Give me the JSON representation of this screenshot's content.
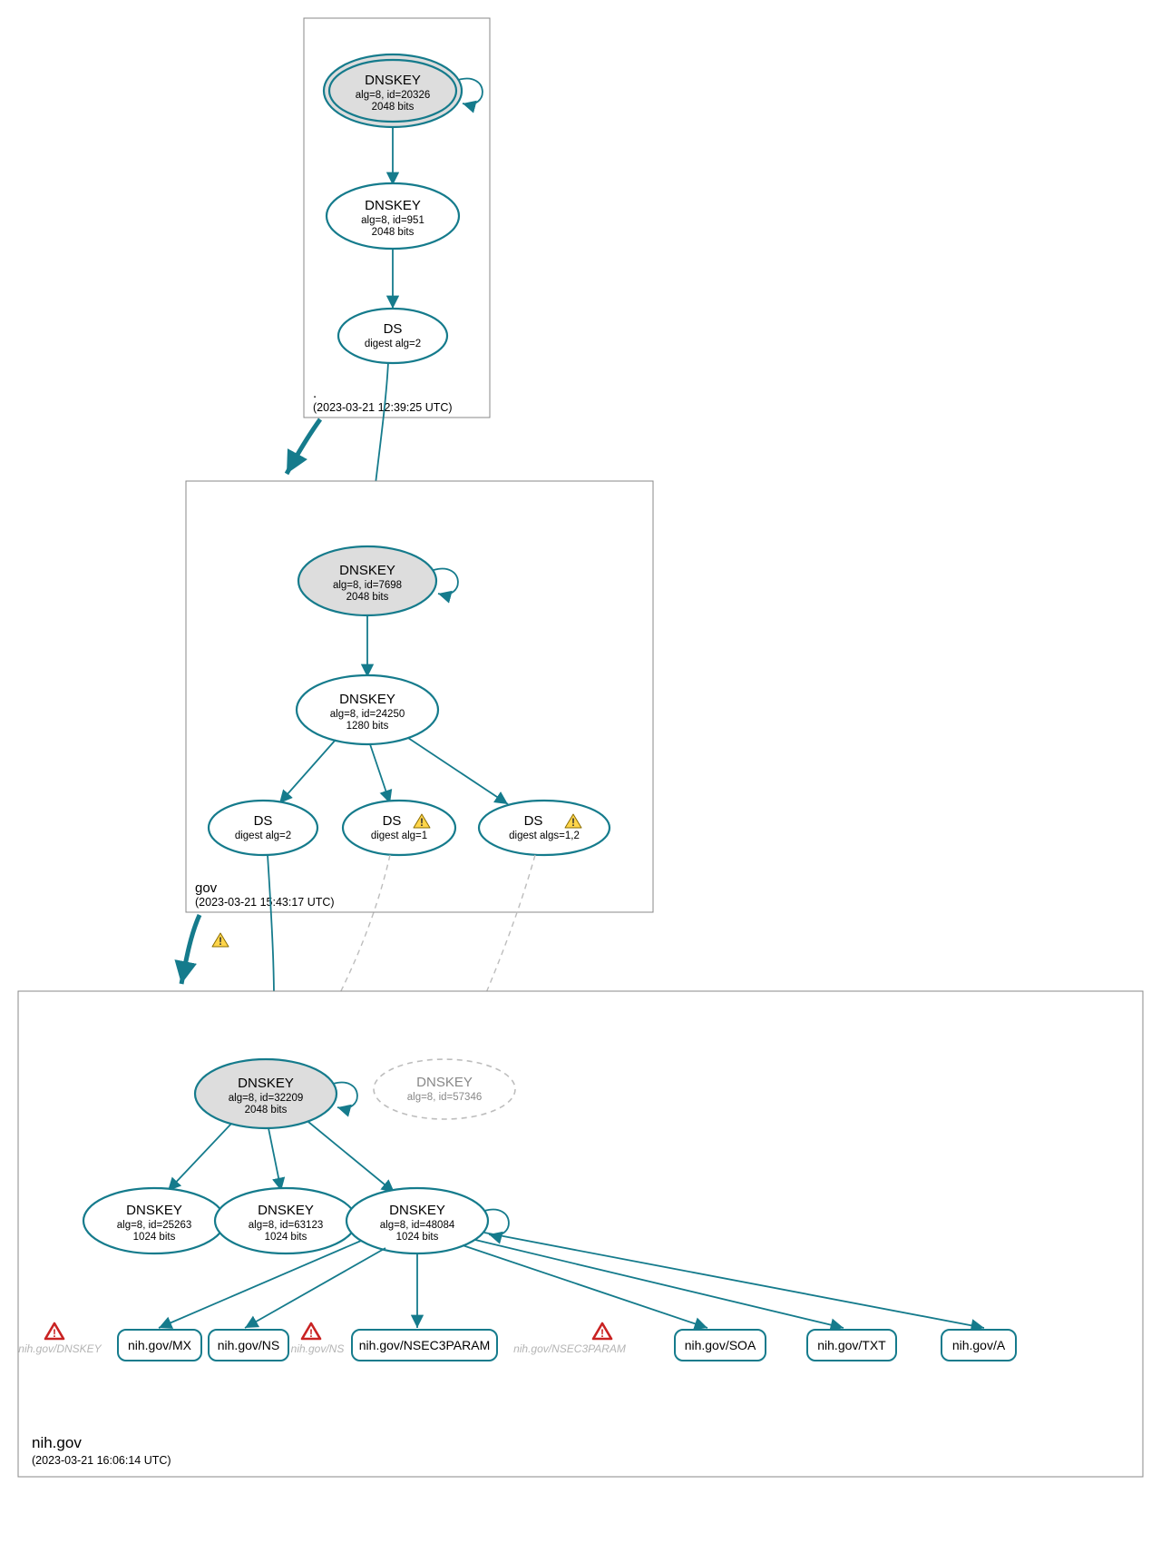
{
  "colors": {
    "teal": "#157b8c",
    "ksk_fill": "#dddddd",
    "ghost": "#bdbdbd"
  },
  "zones": {
    "root": {
      "label": ".",
      "ts": "(2023-03-21 12:39:25 UTC)"
    },
    "gov": {
      "label": "gov",
      "ts": "(2023-03-21 15:43:17 UTC)"
    },
    "nih": {
      "label": "nih.gov",
      "ts": "(2023-03-21 16:06:14 UTC)"
    }
  },
  "nodes": {
    "root_ksk": {
      "title": "DNSKEY",
      "sub1": "alg=8, id=20326",
      "sub2": "2048 bits"
    },
    "root_zsk": {
      "title": "DNSKEY",
      "sub1": "alg=8, id=951",
      "sub2": "2048 bits"
    },
    "root_ds": {
      "title": "DS",
      "sub1": "digest alg=2"
    },
    "gov_ksk": {
      "title": "DNSKEY",
      "sub1": "alg=8, id=7698",
      "sub2": "2048 bits"
    },
    "gov_zsk": {
      "title": "DNSKEY",
      "sub1": "alg=8, id=24250",
      "sub2": "1280 bits"
    },
    "gov_ds1": {
      "title": "DS",
      "sub1": "digest alg=2"
    },
    "gov_ds2": {
      "title": "DS",
      "sub1": "digest alg=1"
    },
    "gov_ds3": {
      "title": "DS",
      "sub1": "digest algs=1,2"
    },
    "nih_ksk": {
      "title": "DNSKEY",
      "sub1": "alg=8, id=32209",
      "sub2": "2048 bits"
    },
    "nih_ghost": {
      "title": "DNSKEY",
      "sub1": "alg=8, id=57346"
    },
    "nih_z1": {
      "title": "DNSKEY",
      "sub1": "alg=8, id=25263",
      "sub2": "1024 bits"
    },
    "nih_z2": {
      "title": "DNSKEY",
      "sub1": "alg=8, id=63123",
      "sub2": "1024 bits"
    },
    "nih_z3": {
      "title": "DNSKEY",
      "sub1": "alg=8, id=48084",
      "sub2": "1024 bits"
    }
  },
  "rrs": {
    "mx": "nih.gov/MX",
    "ns": "nih.gov/NS",
    "n3p": "nih.gov/NSEC3PARAM",
    "soa": "nih.gov/SOA",
    "txt": "nih.gov/TXT",
    "a": "nih.gov/A"
  },
  "ghosts": {
    "g_dnskey": "nih.gov/DNSKEY",
    "g_ns": "nih.gov/NS",
    "g_n3p": "nih.gov/NSEC3PARAM"
  }
}
